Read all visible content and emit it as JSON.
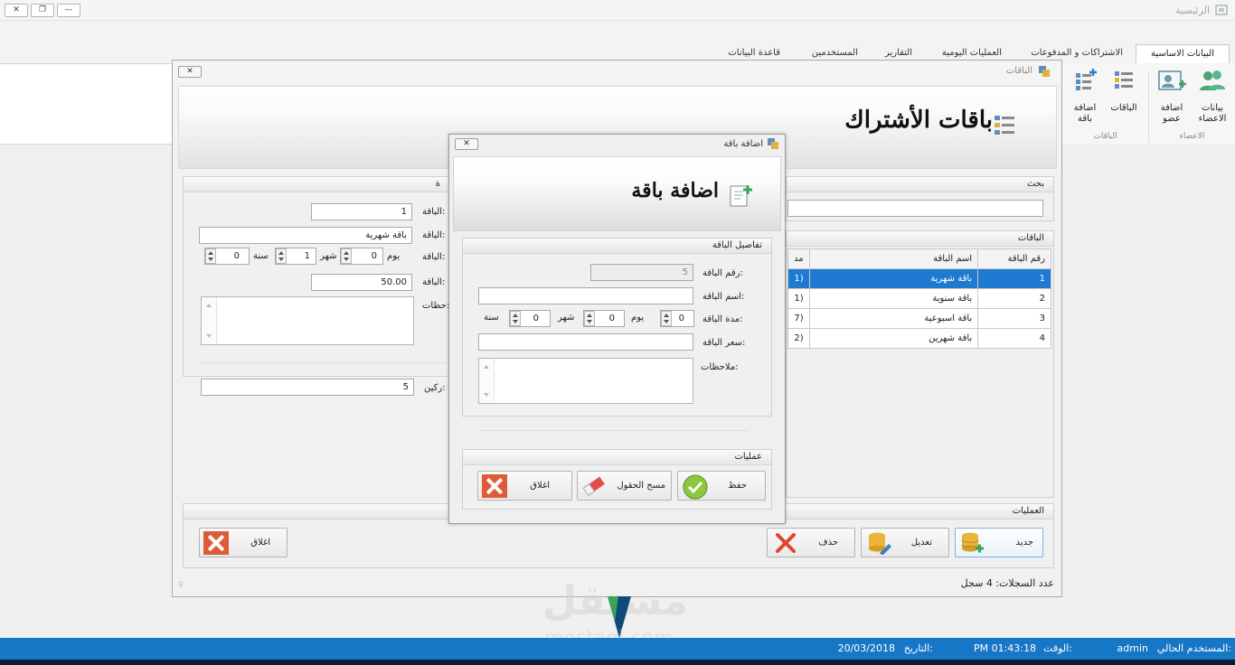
{
  "app": {
    "title": "الرئيسية"
  },
  "ribbon": {
    "tabs": [
      "البيانات الاساسية",
      "الاشتراكات و المدفوعات",
      "العمليات اليومية",
      "التقارير",
      "المستخدمين",
      "قاعدة البيانات"
    ],
    "buttons": {
      "members_data": "بيانات الاعضاء",
      "add_member": "اضافة عضو",
      "packages": "الباقات",
      "add_package": "اضافة باقة"
    },
    "groups": {
      "members": "الاعضاء",
      "packages": "الباقات"
    }
  },
  "main_window": {
    "title": "الباقات",
    "heading": "باقات الأشتراك",
    "search_label": "بحث",
    "search_value": "",
    "grid_panel_label": "الباقات",
    "grid_headers": [
      "رقم الباقة",
      "اسم الباقة",
      "مد"
    ],
    "rows": [
      {
        "num": "1",
        "name": "باقة شهرية",
        "dur": "(1"
      },
      {
        "num": "2",
        "name": "باقة سنوية",
        "dur": "(1"
      },
      {
        "num": "3",
        "name": "باقة اسبوعية",
        "dur": "(7"
      },
      {
        "num": "4",
        "name": "باقة شهرين",
        "dur": "(2"
      }
    ],
    "details_label": "ة",
    "details": {
      "num_label": "الباقة:",
      "num_value": "1",
      "name_label": "الباقة:",
      "name_value": "باقة شهرية",
      "dur_label": "الباقة:",
      "price_label": "الباقة:",
      "price_value": "50.00",
      "notes_label": "حظات:",
      "subscribers_label": "ركين:",
      "subscribers_value": "5"
    },
    "duration": {
      "day_label": "يوم",
      "day_value": "0",
      "month_label": "شهر",
      "month_value": "1",
      "year_label": "سنة",
      "year_value": "0"
    },
    "ops_label": "العمليات",
    "buttons": {
      "new": "جديد",
      "edit": "تعديل",
      "delete": "حذف",
      "close": "اغلاق"
    },
    "records_label": "عدد السجلات:",
    "records_value": "4 سجل"
  },
  "dialog": {
    "title": "اضافة باقة",
    "heading": "اضافة باقة",
    "details_label": "تفاصيل الباقة",
    "num_label": "رقم الباقة:",
    "num_value": "5",
    "name_label": "اسم الباقة:",
    "name_value": "",
    "dur_label": "مدة الباقة:",
    "duration": {
      "day_label": "يوم",
      "day_value": "0",
      "month_label": "شهر",
      "month_value": "0",
      "year_label": "سنة",
      "year_value": "0"
    },
    "price_label": "سعر الباقة:",
    "price_value": "",
    "notes_label": "ملاحظات:",
    "ops_label": "عمليات",
    "buttons": {
      "save": "حفظ",
      "clear": "مسح الحقول",
      "close": "اغلاق"
    }
  },
  "status": {
    "user_label": "المستخدم الحالي:",
    "user_value": "admin",
    "time_label": "الوقت:",
    "time_value": "PM 01:43:18",
    "date_label": "التاريخ:",
    "date_value": "20/03/2018"
  },
  "watermark": {
    "arabic": "مستقل",
    "latin": "mostaql.com"
  },
  "colors": {
    "accent": "#1e79d1",
    "statusbar": "#1677c7",
    "close_red": "#e05a3a"
  }
}
